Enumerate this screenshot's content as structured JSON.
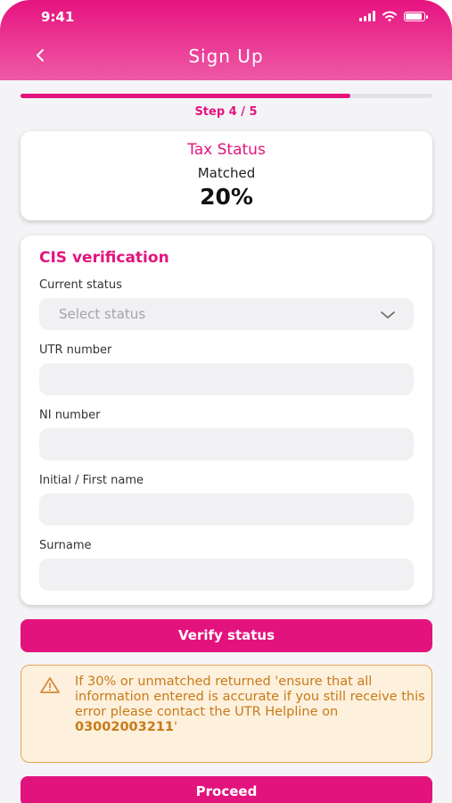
{
  "status_bar": {
    "time": "9:41"
  },
  "header": {
    "title": "Sign Up"
  },
  "progress": {
    "fraction": 0.8,
    "step_label": "Step 4 / 5"
  },
  "tax_status": {
    "title": "Tax Status",
    "subtitle": "Matched",
    "value": "20%"
  },
  "cis": {
    "title": "CIS verification",
    "current_status": {
      "label": "Current status",
      "placeholder": "Select status"
    },
    "utr": {
      "label": "UTR number"
    },
    "ni": {
      "label": "NI number"
    },
    "first_name": {
      "label": "Initial / First name"
    },
    "surname": {
      "label": "Surname"
    }
  },
  "buttons": {
    "verify": "Verify status",
    "proceed": "Proceed"
  },
  "warning": {
    "text": "If 30% or unmatched returned 'ensure that all information entered is accurate if you still receive this error please contact the UTR Helpline on ",
    "phone": "03002003211",
    "suffix": "'"
  },
  "colors": {
    "brand": "#e3137e",
    "warning_bg": "#fdf0dd",
    "warning_border": "#e3a65a",
    "warning_text": "#c87b18"
  }
}
